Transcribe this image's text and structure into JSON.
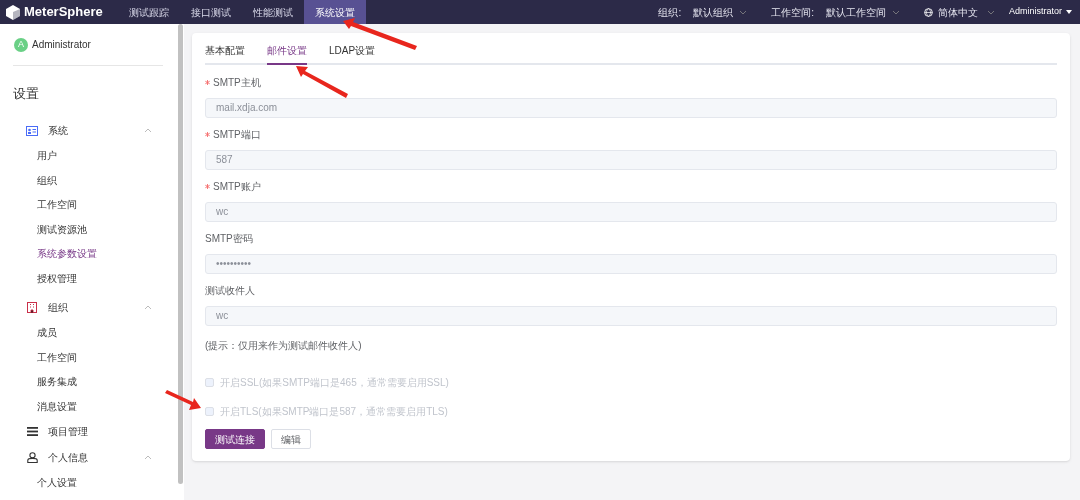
{
  "header": {
    "logo": "MeterSphere",
    "nav": [
      {
        "label": "测试跟踪",
        "selected": false
      },
      {
        "label": "接口测试",
        "selected": false
      },
      {
        "label": "性能测试",
        "selected": false
      },
      {
        "label": "系统设置",
        "selected": true
      }
    ],
    "org_label": "组织:",
    "org_value": "默认组织",
    "workspace_label": "工作空间:",
    "workspace_value": "默认工作空间",
    "language": "简体中文",
    "user": "Administrator"
  },
  "sidebar": {
    "avatar": "A",
    "user": "Administrator",
    "title": "设置",
    "groups": [
      {
        "kind": "system",
        "label": "系统",
        "expanded": true,
        "items": [
          {
            "label": "用户",
            "selected": false
          },
          {
            "label": "组织",
            "selected": false
          },
          {
            "label": "工作空间",
            "selected": false
          },
          {
            "label": "测试资源池",
            "selected": false
          },
          {
            "label": "系统参数设置",
            "selected": true
          },
          {
            "label": "授权管理",
            "selected": false
          }
        ]
      },
      {
        "kind": "org",
        "label": "组织",
        "expanded": true,
        "items": [
          {
            "label": "成员",
            "selected": false
          },
          {
            "label": "工作空间",
            "selected": false
          },
          {
            "label": "服务集成",
            "selected": false
          },
          {
            "label": "消息设置",
            "selected": false
          }
        ]
      },
      {
        "kind": "project",
        "label": "项目管理",
        "expanded": false
      },
      {
        "kind": "person",
        "label": "个人信息",
        "expanded": true,
        "items": [
          {
            "label": "个人设置",
            "selected": false
          }
        ]
      }
    ]
  },
  "tabs": [
    {
      "label": "基本配置",
      "selected": false
    },
    {
      "label": "邮件设置",
      "selected": true
    },
    {
      "label": "LDAP设置",
      "selected": false
    }
  ],
  "fields": [
    {
      "label": "SMTP主机",
      "required": true,
      "placeholder": "mail.xdja.com"
    },
    {
      "label": "SMTP端口",
      "required": true,
      "placeholder": "587"
    },
    {
      "label": "SMTP账户",
      "required": true,
      "placeholder": "wc"
    },
    {
      "label": "SMTP密码",
      "required": false,
      "placeholder": "••••••••••"
    },
    {
      "label": "测试收件人",
      "required": false,
      "placeholder": "wc"
    }
  ],
  "hint": "(提示：仅用来作为测试邮件收件人)",
  "options": [
    {
      "label": "开启SSL(如果SMTP端口是465，通常需要启用SSL)",
      "checked": false
    },
    {
      "label": "开启TLS(如果SMTP端口是587，通常需要启用TLS)",
      "checked": false
    }
  ],
  "buttons": [
    {
      "label": "测试连接",
      "kind": "primary"
    },
    {
      "label": "编辑",
      "kind": "plain"
    }
  ]
}
